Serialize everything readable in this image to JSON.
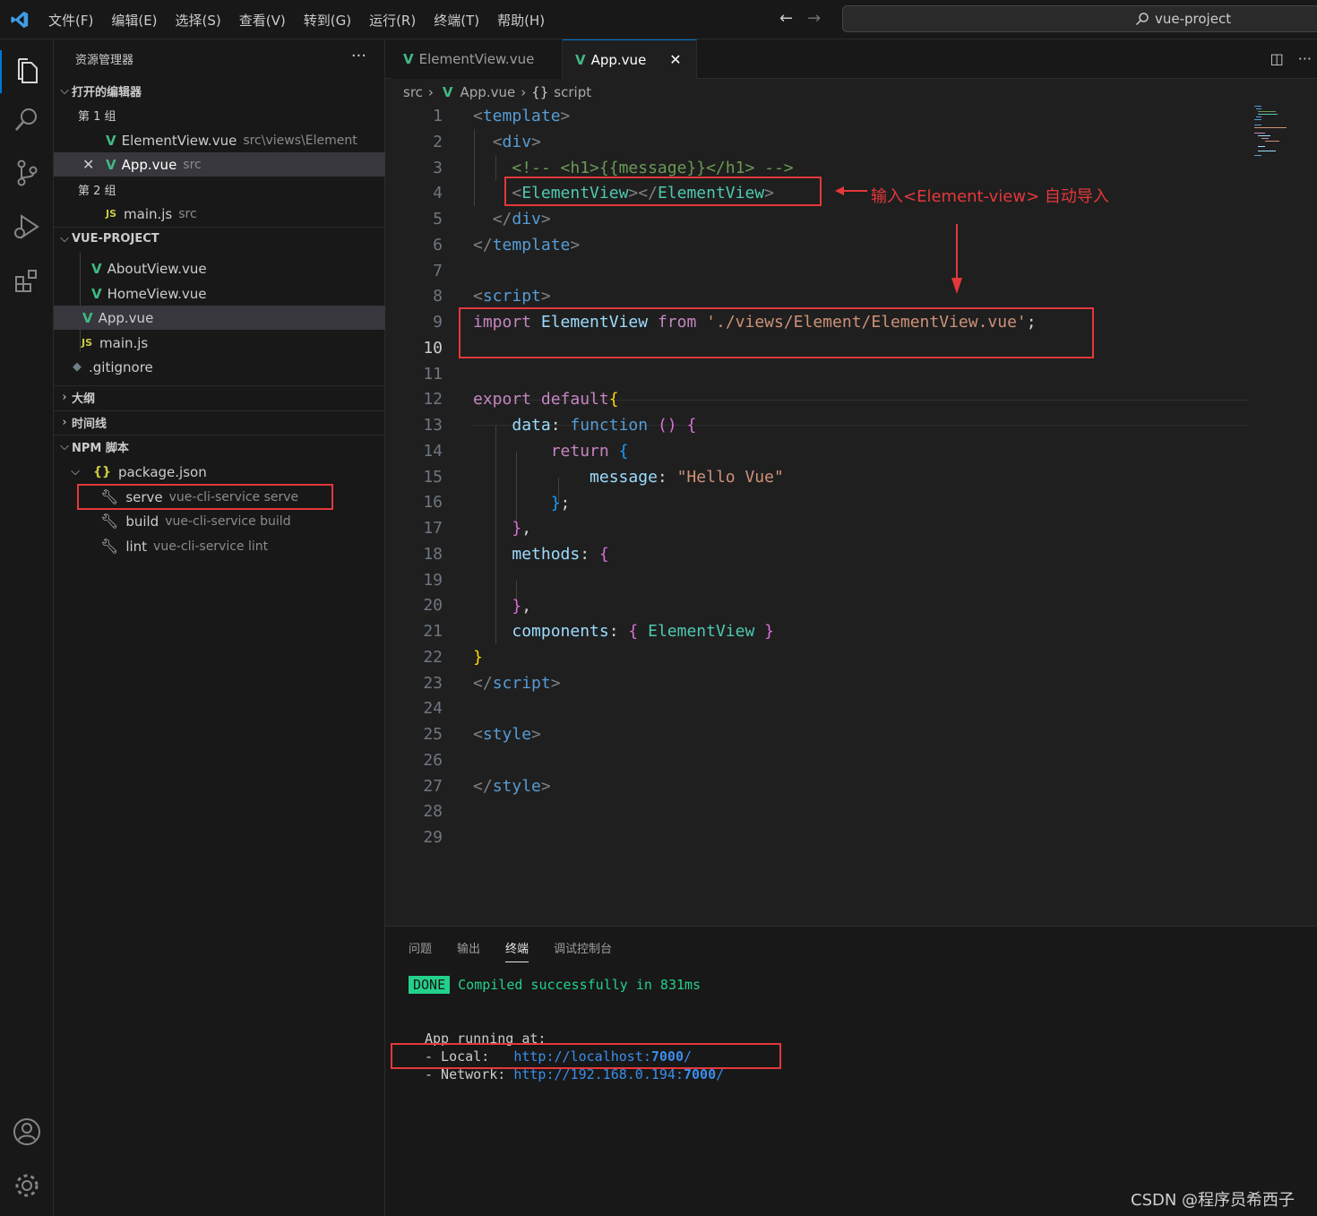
{
  "menu": [
    "文件(F)",
    "编辑(E)",
    "选择(S)",
    "查看(V)",
    "转到(G)",
    "运行(R)",
    "终端(T)",
    "帮助(H)"
  ],
  "search": {
    "text": "vue-project"
  },
  "colors": {
    "accent": "#0078d4",
    "vue": "#41b883",
    "annotation": "#e5383b",
    "done_badge": "#23d18b"
  },
  "sidebar": {
    "title": "资源管理器",
    "more": "···",
    "open_editors": "打开的编辑器",
    "group1": "第 1 组",
    "group2": "第 2 组",
    "open_items": [
      {
        "name": "ElementView.vue",
        "path": "src\\views\\Element"
      },
      {
        "name": "App.vue",
        "path": "src"
      },
      {
        "name": "main.js",
        "path": "src"
      }
    ],
    "project": "VUE-PROJECT",
    "files": [
      "AboutView.vue",
      "HomeView.vue",
      "App.vue",
      "main.js",
      ".gitignore"
    ],
    "outline": "大纲",
    "timeline": "时间线",
    "npm": "NPM 脚本",
    "package": "package.json",
    "scripts": [
      {
        "name": "serve",
        "cmd": "vue-cli-service serve"
      },
      {
        "name": "build",
        "cmd": "vue-cli-service build"
      },
      {
        "name": "lint",
        "cmd": "vue-cli-service lint"
      }
    ]
  },
  "tabs": [
    {
      "label": "ElementView.vue",
      "active": false
    },
    {
      "label": "App.vue",
      "active": true
    }
  ],
  "breadcrumb": {
    "folder": "src",
    "file": "App.vue",
    "symbol": "script"
  },
  "code": {
    "current_line": 10,
    "line_numbers": [
      "1",
      "2",
      "3",
      "4",
      "5",
      "6",
      "7",
      "8",
      "9",
      "10",
      "11",
      "12",
      "13",
      "14",
      "15",
      "16",
      "17",
      "18",
      "19",
      "20",
      "21",
      "22",
      "23",
      "24",
      "25",
      "26",
      "27",
      "28",
      "29"
    ]
  },
  "annotation": {
    "text": "输入<Element-view> 自动导入"
  },
  "panel": {
    "tabs": [
      "问题",
      "输出",
      "终端",
      "调试控制台"
    ],
    "active_tab": "终端",
    "done": "DONE",
    "compiled": "Compiled successfully in 831ms",
    "running": "App running at:",
    "local_label": "- Local:   ",
    "local_url_prefix": "http://localhost:",
    "local_port": "7000",
    "network_label": "- Network: ",
    "network_url_prefix": "http://192.168.0.194:",
    "network_port": "7000"
  },
  "watermark": "CSDN @程序员希西子"
}
